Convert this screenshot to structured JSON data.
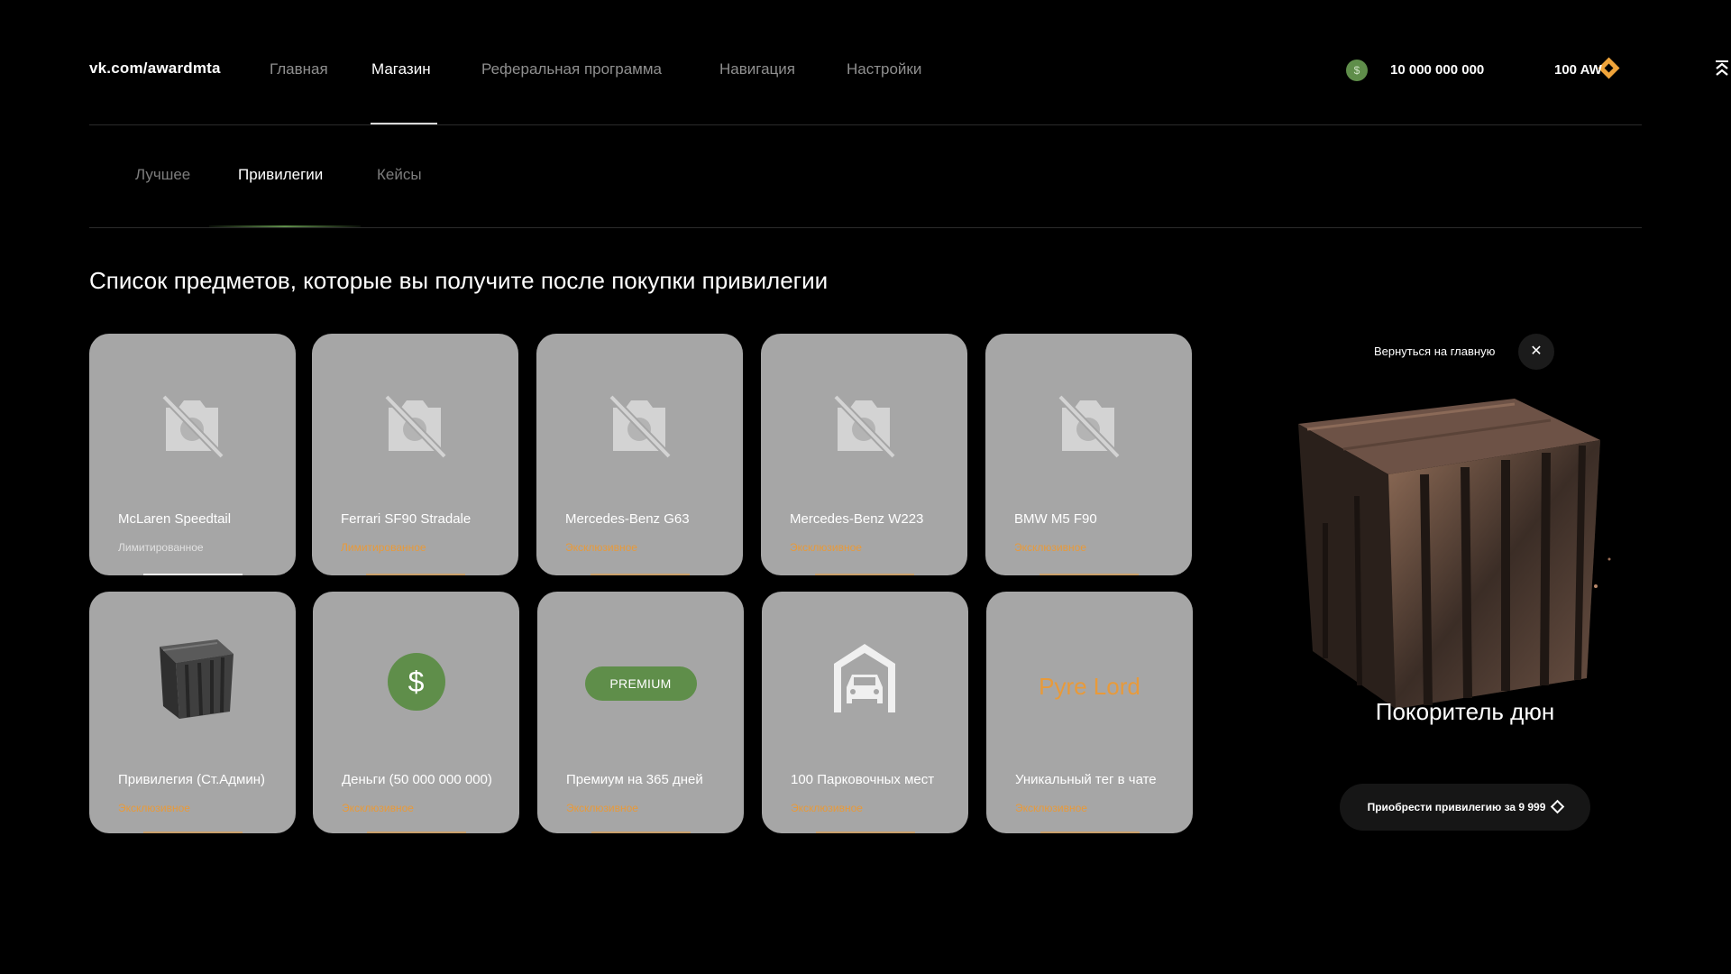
{
  "header": {
    "logo": "vk.com/awardmta",
    "nav": [
      "Главная",
      "Магазин",
      "Реферальная программа",
      "Навигация",
      "Настройки"
    ],
    "active_nav": "Магазин",
    "money_value": "10 000 000 000",
    "aw_value": "100 AW",
    "money_icon": "dollar-coin-icon",
    "aw_icon": "diamond-icon",
    "menu_icon": "chevron-collapse-icon"
  },
  "subtabs": {
    "items": [
      "Лучшее",
      "Привилегии",
      "Кейсы"
    ],
    "active": "Привилегии"
  },
  "section_title": "Список предметов, которые вы получите после покупки привилегии",
  "cards": [
    {
      "name": "McLaren Speedtail",
      "rarity": "Лимитированное",
      "icon": "no-photo-icon"
    },
    {
      "name": "Ferrari SF90 Stradale",
      "rarity": "Лимитированное",
      "icon": "no-photo-icon"
    },
    {
      "name": "Mercedes-Benz G63",
      "rarity": "Эксклюзивное",
      "icon": "no-photo-icon"
    },
    {
      "name": "Mercedes-Benz W223",
      "rarity": "Эксклюзивное",
      "icon": "no-photo-icon"
    },
    {
      "name": "BMW M5 F90",
      "rarity": "Эксклюзивное",
      "icon": "no-photo-icon"
    },
    {
      "name": "Привилегия (Ст.Админ)",
      "rarity": "Эксклюзивное",
      "icon": "crate-icon"
    },
    {
      "name": "Деньги (50 000 000 000)",
      "rarity": "Эксклюзивное",
      "icon": "dollar-icon",
      "badge": "$"
    },
    {
      "name": "Премиум на 365 дней",
      "rarity": "Эксклюзивное",
      "icon": "premium-badge",
      "badge": "PREMIUM"
    },
    {
      "name": "100 Парковочных мест",
      "rarity": "Эксклюзивное",
      "icon": "garage-car-icon"
    },
    {
      "name": "Уникальный тег в чате",
      "rarity": "Эксклюзивное",
      "icon": "tag-text",
      "badge": "Pyre Lord"
    }
  ],
  "panel": {
    "back_label": "Вернуться на главную",
    "close_icon": "✕",
    "privilege_name": "Покоритель дюн",
    "buy_label": "Приобрести привилегию за 9 999"
  },
  "colors": {
    "background": "#000000",
    "card": "#a6a6a6",
    "accent_green": "#5f8e4a",
    "accent_orange": "#e89a3a"
  }
}
